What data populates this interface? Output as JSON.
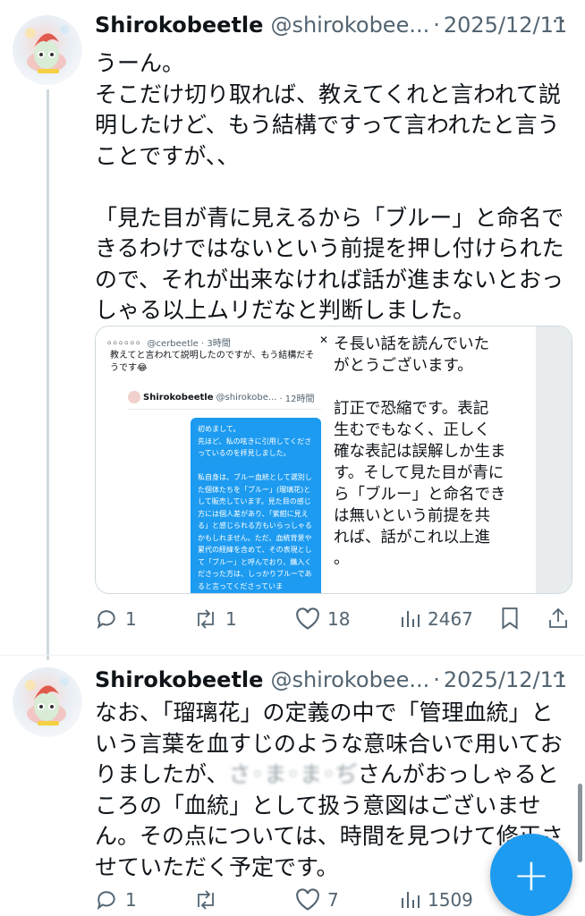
{
  "tweets": [
    {
      "name": "Shirokobeetle",
      "handle": "@shirokobee...",
      "dot": "·",
      "date": "2025/12/11",
      "more": "···",
      "text": "うーん。\nそこだけ切り取れば、教えてくれと言われて説明したけど、もう結構ですって言われたと言うことですが、、\n\n「見た目が青に見えるから「ブルー」と命名できるわけではないという前提を押し付けられたので、それが出来なければ話が進まないとおっしゃる以上ムリだなと判断しました。",
      "metrics": {
        "replies": "1",
        "reposts": "1",
        "likes": "18",
        "views": "2467"
      }
    },
    {
      "name": "Shirokobeetle",
      "handle": "@shirokobee...",
      "dot": "·",
      "date": "2025/12/11",
      "more": "···",
      "text_before": "なお、「瑠璃花」の定義の中で「管理血統」という言葉を血すじのような意味合いで用いておりましたが、",
      "redacted": "さ◦ま◦ま◦ぢ",
      "text_after": "さんがおっしゃるところの「血統」として扱う意図はございません。その点については、時間を見つけて修正させていただく予定です。",
      "metrics": {
        "replies": "1",
        "reposts": "",
        "likes": "7",
        "views": "1509"
      }
    }
  ],
  "quote_card": {
    "quoted_name": "◦◦◦◦◦◦",
    "quoted_handle": "@cerbeetle",
    "quoted_time": "· 3時間",
    "close": "✕",
    "quoted_text": "教えてと言われて説明したのですが、もう結構だそうです😂",
    "inner_name": "Shirokobeetle",
    "inner_handle": "@shirokobe...",
    "inner_time": "· 12時間",
    "blue_text": "初めまして。\n先ほど、私の呟きに引用してくださっているのを拝見しました。\n\n私自身は、ブルー血統として選別した個体たちを「ブルー」(瑠璃花)として販売しています。見た目の感じ方には個人差があり、「紫紺に見える」と感じられる方もいらっしゃるかもしれません。ただ、血統背景や累代の経緯を含めて、その表現として「ブルー」と呼んでおり、購入くださった方は、しっかりブルーであると言ってくださっていま",
    "right_lines": [
      "そ長い話を読んでいた",
      "がとうございます。",
      "",
      "訂正で恐縮です。表記",
      "生むでもなく、正しく",
      "確な表記は誤解しか生ま",
      "す。そして見た目が青に",
      "ら「ブルー」と命名でき",
      "は無いという前提を共",
      "れば、話がこれ以上進",
      "。"
    ]
  },
  "fab_label": "+",
  "colors": {
    "accent": "#1d9bf0",
    "muted": "#536471",
    "text": "#0f1419",
    "border": "#cfd9de"
  }
}
